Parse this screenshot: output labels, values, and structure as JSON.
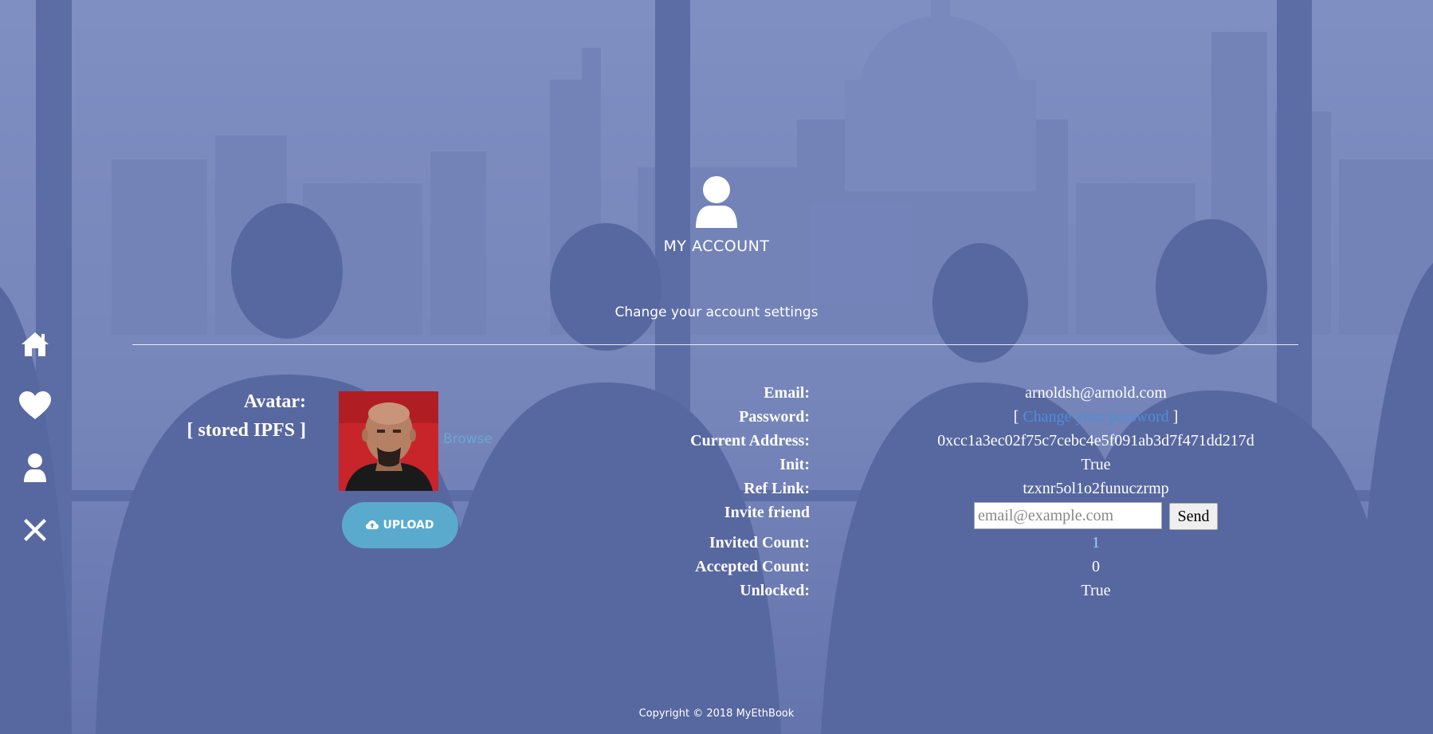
{
  "header": {
    "title": "MY ACCOUNT",
    "subtitle": "Change your account settings"
  },
  "nav": {
    "items": [
      {
        "icon": "home-icon"
      },
      {
        "icon": "heart-icon"
      },
      {
        "icon": "user-icon"
      },
      {
        "icon": "close-icon"
      }
    ]
  },
  "avatar": {
    "label": "Avatar:",
    "sublabel": "[ stored IPFS ]",
    "browse_label": "Browse",
    "upload_label": "UPLOAD",
    "upload_icon": "cloud-upload-icon"
  },
  "account": {
    "email_label": "Email:",
    "email": "arnoldsh@arnold.com",
    "password_label": "Password:",
    "password_prefix": "[ ",
    "password_link": "Change your password",
    "password_suffix": " ]",
    "address_label": "Current Address:",
    "address": "0xcc1a3ec02f75c7cebc4e5f091ab3d7f471dd217d",
    "init_label": "Init:",
    "init": "True",
    "reflink_label": "Ref Link:",
    "reflink": "tzxnr5ol1o2funuczrmp",
    "invite_label": "Invite friend",
    "invite_placeholder": "email@example.com",
    "send_label": "Send",
    "invited_label": "Invited Count:",
    "invited": "1",
    "accepted_label": "Accepted Count:",
    "accepted": "0",
    "unlocked_label": "Unlocked:",
    "unlocked": "True"
  },
  "footer": {
    "copyright": "Copyright © 2018 MyEthBook"
  },
  "colors": {
    "overlay": "#5f6fa6",
    "upload_button": "#5aaace",
    "link": "#4d8fd8",
    "browse_link": "#6aa7d4"
  }
}
